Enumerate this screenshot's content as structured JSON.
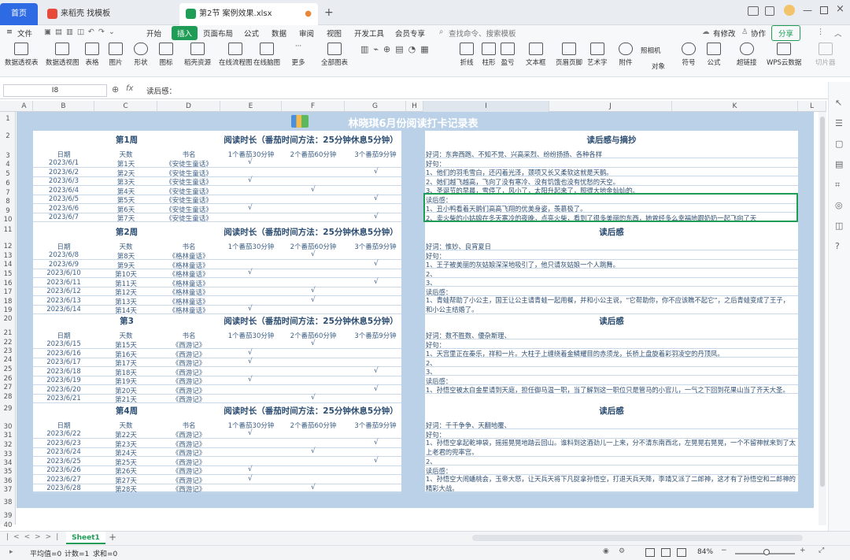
{
  "tabs": {
    "home": "首页",
    "template": "来稻壳 找模板",
    "file": "第2节 案例效果.xlsx"
  },
  "menu": {
    "file": "文件",
    "items": [
      "开始",
      "插入",
      "页面布局",
      "公式",
      "数据",
      "审阅",
      "视图",
      "开发工具",
      "会员专享"
    ],
    "search": "查找命令、搜索模板",
    "edit": "有修改",
    "collab": "协作",
    "share": "分享"
  },
  "ribbon": [
    "数据透视表",
    "数据透视图",
    "表格",
    "图片",
    "形状",
    "图标",
    "稻壳资源",
    "在线流程图",
    "在线脑图",
    "更多",
    "全部图表",
    "折线",
    "柱形",
    "盈亏",
    "文本框",
    "页眉页脚",
    "艺术字",
    "附件",
    "对象",
    "符号",
    "公式",
    "超链接",
    "WPS云数据",
    "切片器"
  ],
  "ribbon_extra": "照相机",
  "formula": {
    "cell": "I8",
    "fx": "fx",
    "content": "读后感："
  },
  "columns": [
    "A",
    "B",
    "C",
    "D",
    "E",
    "F",
    "G",
    "H",
    "I",
    "J",
    "K",
    "L"
  ],
  "rows": [
    "1",
    "2",
    "3",
    "4",
    "5",
    "6",
    "7",
    "8",
    "9",
    "10",
    "11",
    "12",
    "13",
    "14",
    "15",
    "16",
    "17",
    "18",
    "19",
    "20",
    "21",
    "22",
    "23",
    "24",
    "25",
    "26",
    "27",
    "28",
    "29",
    "30",
    "31",
    "32",
    "33",
    "34",
    "35",
    "36",
    "37",
    "38",
    "39",
    "40"
  ],
  "title": "林晓琪6月份阅读打卡记录表",
  "headers": {
    "date": "日期",
    "day": "天数",
    "book": "书名",
    "p30": "1个番茄30分钟",
    "p60": "2个番茄60分钟",
    "p90": "3个番茄9分钟"
  },
  "weeks": [
    {
      "label": "第1周",
      "time": "阅读时长（番茄时间方法：25分钟休息5分钟）",
      "rows": [
        [
          "2023/6/1",
          "第1天",
          "《安徒生童话》",
          1
        ],
        [
          "2023/6/2",
          "第2天",
          "《安徒生童话》",
          3
        ],
        [
          "2023/6/3",
          "第3天",
          "《安徒生童话》",
          1
        ],
        [
          "2023/6/4",
          "第4天",
          "《安徒生童话》",
          2
        ],
        [
          "2023/6/5",
          "第5天",
          "《安徒生童话》",
          3
        ],
        [
          "2023/6/6",
          "第6天",
          "《安徒生童话》",
          1
        ],
        [
          "2023/6/7",
          "第7天",
          "《安徒生童话》",
          3
        ]
      ]
    },
    {
      "label": "第2周",
      "time": "阅读时长（番茄时间方法：25分钟休息5分钟）",
      "rows": [
        [
          "2023/6/8",
          "第8天",
          "《格林童话》",
          2
        ],
        [
          "2023/6/9",
          "第9天",
          "《格林童话》",
          3
        ],
        [
          "2023/6/10",
          "第10天",
          "《格林童话》",
          1
        ],
        [
          "2023/6/11",
          "第11天",
          "《格林童话》",
          3
        ],
        [
          "2023/6/12",
          "第12天",
          "《格林童话》",
          2
        ],
        [
          "2023/6/13",
          "第13天",
          "《格林童话》",
          2
        ],
        [
          "2023/6/14",
          "第14天",
          "《格林童话》",
          1
        ]
      ]
    },
    {
      "label": "第3",
      "time": "阅读时长（番茄时间方法：25分钟休息5分钟）",
      "rows": [
        [
          "2023/6/15",
          "第15天",
          "《西游记》",
          2
        ],
        [
          "2023/6/16",
          "第16天",
          "《西游记》",
          1
        ],
        [
          "2023/6/17",
          "第17天",
          "《西游记》",
          1
        ],
        [
          "2023/6/18",
          "第18天",
          "《西游记》",
          3
        ],
        [
          "2023/6/19",
          "第19天",
          "《西游记》",
          1
        ],
        [
          "2023/6/20",
          "第20天",
          "《西游记》",
          3
        ],
        [
          "2023/6/21",
          "第21天",
          "《西游记》",
          2
        ]
      ]
    },
    {
      "label": "第4周",
      "time": "阅读时长（番茄时间方法：25分钟休息5分钟）",
      "rows": [
        [
          "2023/6/22",
          "第22天",
          "《西游记》",
          1
        ],
        [
          "2023/6/23",
          "第23天",
          "《西游记》",
          3
        ],
        [
          "2023/6/24",
          "第24天",
          "《西游记》",
          2
        ],
        [
          "2023/6/25",
          "第25天",
          "《西游记》",
          3
        ],
        [
          "2023/6/26",
          "第26天",
          "《西游记》",
          1
        ],
        [
          "2023/6/27",
          "第27天",
          "《西游记》",
          1
        ],
        [
          "2023/6/28",
          "第28天",
          "《西游记》",
          2
        ]
      ]
    }
  ],
  "check": "√",
  "reviews": [
    {
      "title": "读后感与摘抄",
      "lines": [
        "好词：东奔西跑、不知不觉、兴高采烈、纷纷扬扬、各种各样",
        "好句：",
        "1、他们的羽毛雪白，还闪着光泽，颈项又长又柔软这就是天鹅。",
        "2、她们越飞越高，飞向了没有寒冷、没有饥饿也没有忧愁的天空。",
        "3、圣诞节的早晨，雪停了，风小了，太阳升起来了，照得大地金灿灿的。",
        "读后感：",
        "1、丑小鸭看着天鹅们高高飞翔的优美身姿，羡慕极了。",
        "2、卖火柴的小姑娘在冬天寒冷的夜晚，点亮火柴，看到了很多美丽的东西，她曾经多么幸福地跟奶奶一起飞向了天"
      ]
    },
    {
      "title": "读后感",
      "lines": [
        "好词：惟妙、良宵夏日",
        "好句：",
        "1、王子被美丽的灰姑娘深深地吸引了，他只请灰姑娘一个人跳舞。",
        "2、",
        "3、",
        "读后感：",
        "1、青蛙帮助了小公主，国王让公主请青蛙一起用餐，并和小公主说，“它帮助你，你不应该瞧不起它”，之后青蛙变成了王子，和小公主结婚了。"
      ]
    },
    {
      "title": "读后感",
      "lines": [
        "好词：数不胜数、優杂斯理、",
        "好句：",
        "1、天宫里正在秦乐，祥和一片。大柱子上缠绕着金鳞耀目的赤须龙，长桥上盘旋着彩羽凌空的丹顶凤。",
        "2、",
        "3、",
        "读后感：",
        "1、孙悟空被太白金星请到天庭，担任御马温一职，当了解到这一职位只是管马的小官儿，一气之下回到花果山当了齐天大圣。"
      ]
    },
    {
      "title": "读后感",
      "lines": [
        "好词：千千争争、天翻地覆、",
        "好句：",
        "1、孙悟空拿起乾坤袋，摇摇晃晃地踏云回山。谁料到这酒劲儿一上来，分不清东南西北，左晃晃右晃晃，一个不留神就来到了太上老君的兜率宫。",
        "2、",
        "读后感：",
        "1、孙悟空大闹蟠桃会，玉帝大怒，让天兵天将下凡捉拿孙悟空，打退天兵天降，李靖又派了二郎神，这才有了孙悟空和二郎神的精彩大战。"
      ]
    }
  ],
  "sheet_tab": "Sheet1",
  "status": {
    "avg": "平均值=0",
    "count": "计数=1",
    "sum": "求和=0",
    "zoom": "84%"
  }
}
